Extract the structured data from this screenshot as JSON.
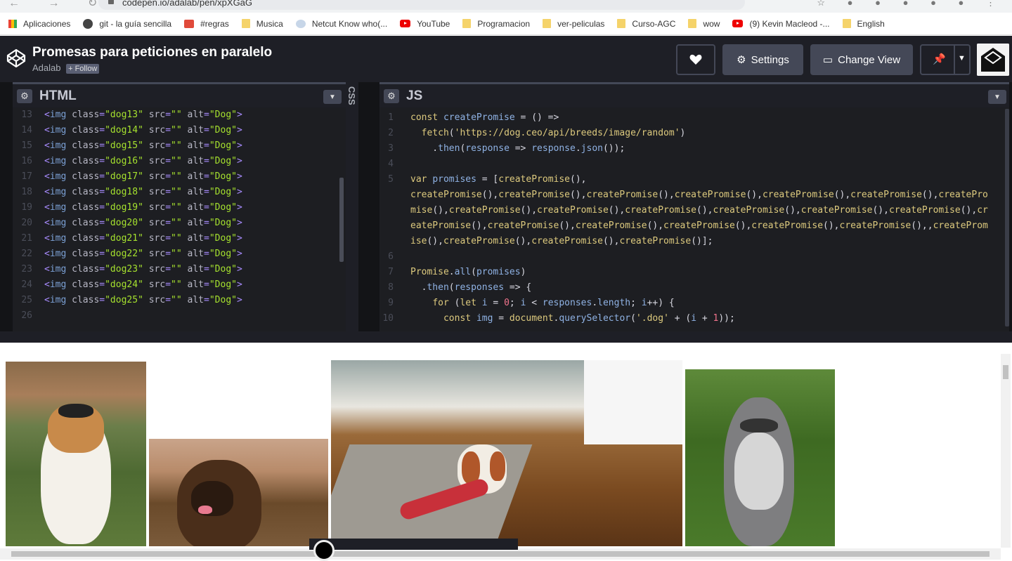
{
  "browser": {
    "url": "codepen.io/adalab/pen/xpXGaG"
  },
  "bookmarks": [
    {
      "label": "Aplicaciones",
      "icon": "apps"
    },
    {
      "label": "git - la guía sencilla",
      "icon": "globe"
    },
    {
      "label": "#regras",
      "icon": "cal"
    },
    {
      "label": "Musica",
      "icon": "folder"
    },
    {
      "label": "Netcut Know who(...",
      "icon": "net"
    },
    {
      "label": "YouTube",
      "icon": "yt"
    },
    {
      "label": "Programacion",
      "icon": "folder"
    },
    {
      "label": "ver-peliculas",
      "icon": "folder"
    },
    {
      "label": "Curso-AGC",
      "icon": "folder"
    },
    {
      "label": "wow",
      "icon": "folder"
    },
    {
      "label": "(9) Kevin Macleod -...",
      "icon": "yt"
    },
    {
      "label": "English",
      "icon": "folder"
    }
  ],
  "header": {
    "title": "Promesas para peticiones en paralelo",
    "author": "Adalab",
    "follow": "+ Follow",
    "settings": "Settings",
    "change_view": "Change View"
  },
  "html_editor": {
    "name": "HTML",
    "lines": [
      {
        "n": "13",
        "cls": "dog13"
      },
      {
        "n": "14",
        "cls": "dog14"
      },
      {
        "n": "15",
        "cls": "dog15"
      },
      {
        "n": "16",
        "cls": "dog16"
      },
      {
        "n": "17",
        "cls": "dog17"
      },
      {
        "n": "18",
        "cls": "dog18"
      },
      {
        "n": "19",
        "cls": "dog19"
      },
      {
        "n": "20",
        "cls": "dog20"
      },
      {
        "n": "21",
        "cls": "dog21"
      },
      {
        "n": "22",
        "cls": "dog22"
      },
      {
        "n": "23",
        "cls": "dog23"
      },
      {
        "n": "24",
        "cls": "dog24"
      },
      {
        "n": "25",
        "cls": "dog25"
      },
      {
        "n": "26",
        "cls": ""
      }
    ]
  },
  "css_editor": {
    "name": "CSS"
  },
  "js_editor": {
    "name": "JS",
    "lines": [
      {
        "n": "1",
        "html": "<span class='k'>const</span> <span class='v'>createPromise</span> = () =>"
      },
      {
        "n": "2",
        "html": "  <span class='k'>fetch</span>(<span class='k'>'https://dog.ceo/api/breeds/image/random'</span>)"
      },
      {
        "n": "3",
        "html": "    .<span class='v'>then</span>(<span class='v'>response</span> => <span class='v'>response</span>.<span class='v'>json</span>());"
      },
      {
        "n": "4",
        "html": ""
      },
      {
        "n": "5",
        "html": "<span class='k'>var</span> <span class='v'>promises</span> = [<span class='k'>createPromise</span>(),"
      },
      {
        "n": "",
        "html": "<span class='k'>createPromise</span>(),<span class='k'>createPromise</span>(),<span class='k'>createPromise</span>(),<span class='k'>createPromise</span>(),<span class='k'>createPromise</span>(),<span class='k'>createPromise</span>(),<span class='k'>createPro</span>"
      },
      {
        "n": "",
        "html": "<span class='k'>mise</span>(),<span class='k'>createPromise</span>(),<span class='k'>createPromise</span>(),<span class='k'>createPromise</span>(),<span class='k'>createPromise</span>(),<span class='k'>createPromise</span>(),<span class='k'>createPromise</span>(),<span class='k'>cr</span>"
      },
      {
        "n": "",
        "html": "<span class='k'>eatePromise</span>(),<span class='k'>createPromise</span>(),<span class='k'>createPromise</span>(),<span class='k'>createPromise</span>(),<span class='k'>createPromise</span>(),<span class='k'>createPromise</span>(),,<span class='k'>createProm</span>"
      },
      {
        "n": "",
        "html": "<span class='k'>ise</span>(),<span class='k'>createPromise</span>(),<span class='k'>createPromise</span>(),<span class='k'>createPromise</span>()];"
      },
      {
        "n": "6",
        "html": ""
      },
      {
        "n": "7",
        "html": "<span class='k'>Promise</span>.<span class='v'>all</span>(<span class='v'>promises</span>)"
      },
      {
        "n": "8",
        "html": "  .<span class='v'>then</span>(<span class='v'>responses</span> => {"
      },
      {
        "n": "9",
        "html": "    <span class='k'>for</span> (<span class='k'>let</span> <span class='v'>i</span> = <span class='n'>0</span>; <span class='v'>i</span> &lt; <span class='v'>responses</span>.<span class='v'>length</span>; <span class='v'>i</span>++) {"
      },
      {
        "n": "10",
        "html": "      <span class='k'>const</span> <span class='v'>img</span> = <span class='k'>document</span>.<span class='v'>querySelector</span>(<span class='k'>'.dog'</span> + (<span class='v'>i</span> + <span class='n'>1</span>));"
      }
    ]
  },
  "preview": {
    "images": [
      {
        "alt": "Dog"
      },
      {
        "alt": "Dog"
      },
      {
        "alt": "Dog"
      },
      {
        "alt": "Dog"
      }
    ]
  },
  "colors": {
    "editor_bg": "#1d1e22",
    "header_bg": "#1e1f26",
    "button_bg": "#444857"
  }
}
